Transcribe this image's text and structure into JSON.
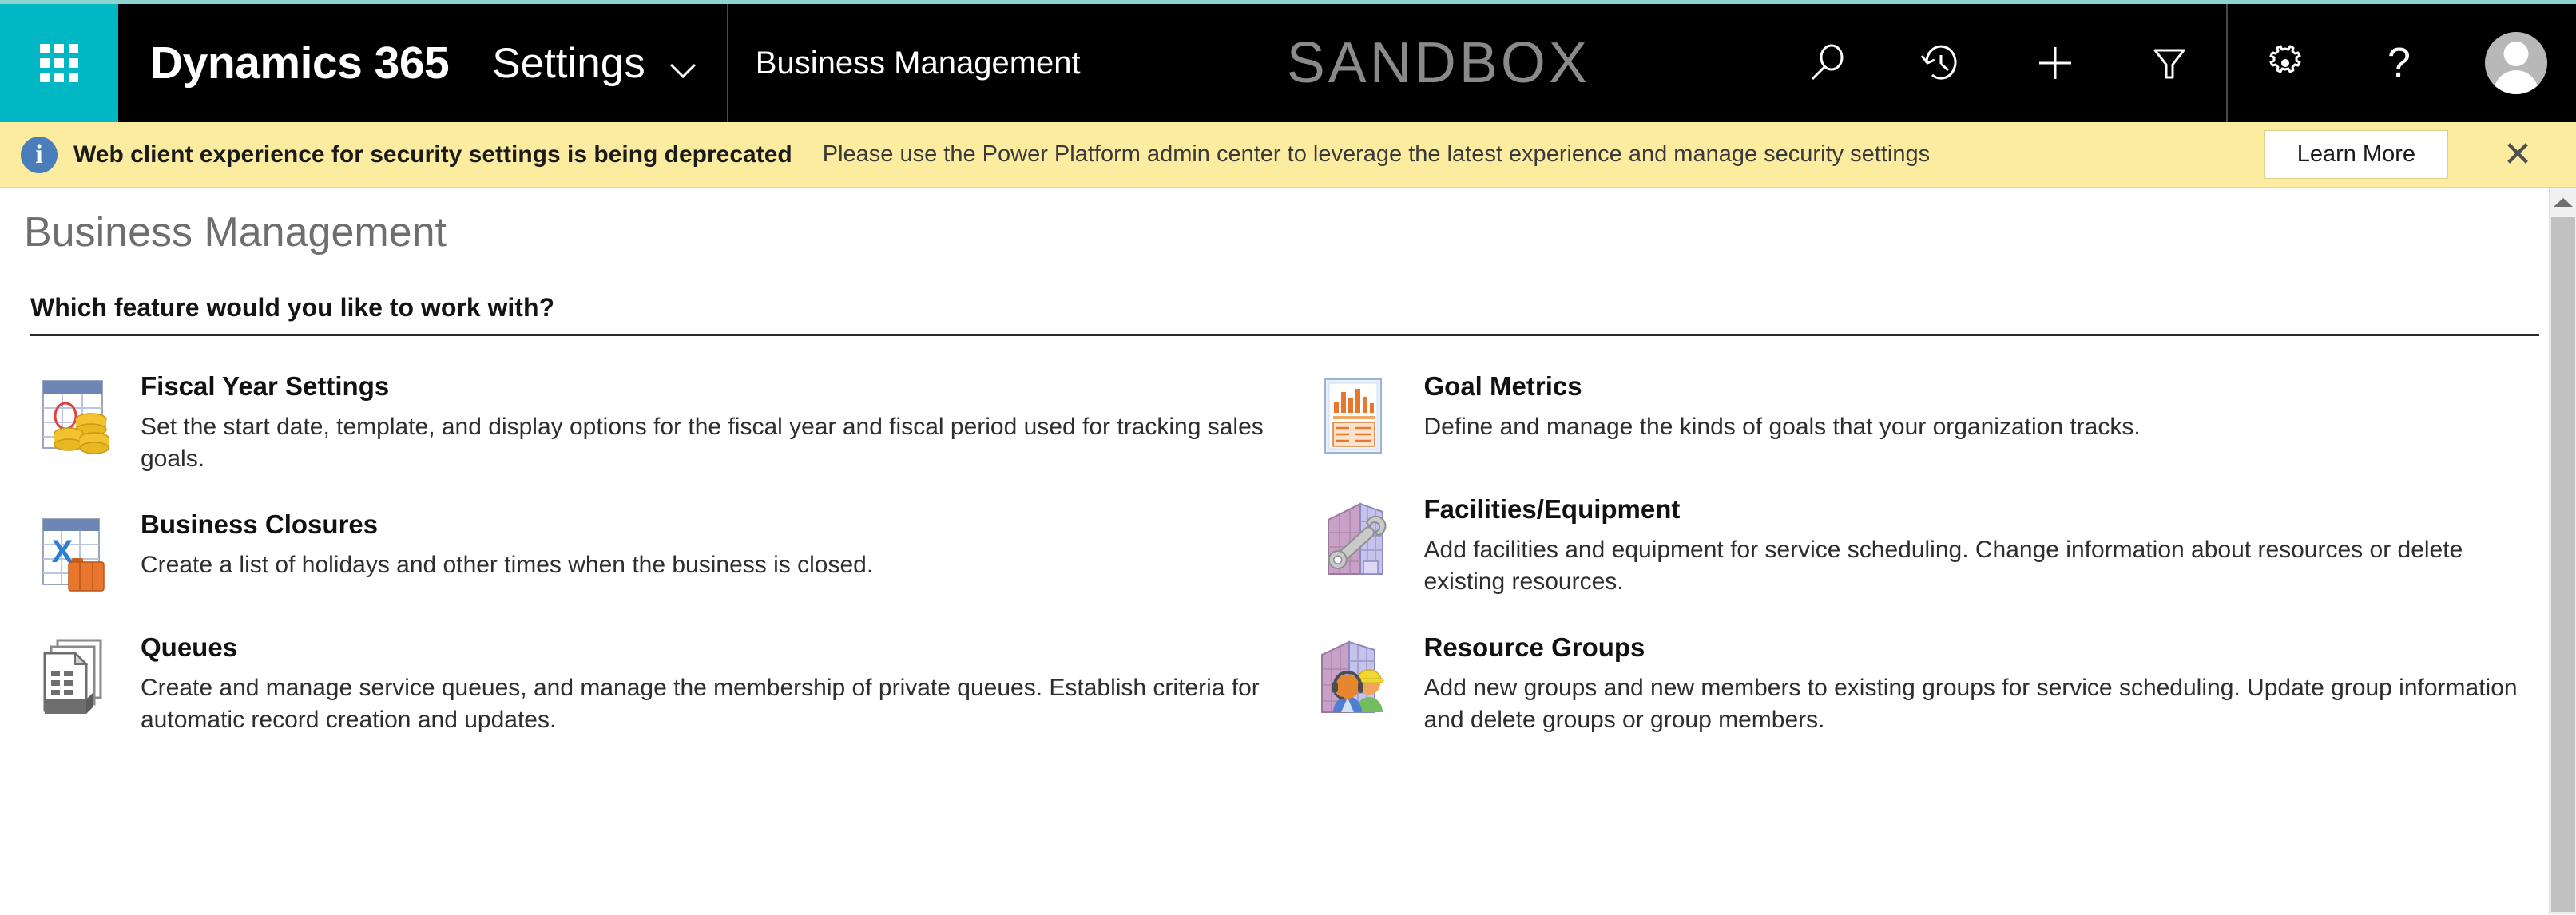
{
  "topbar": {
    "waffle_label": "App launcher",
    "brand": "Dynamics 365",
    "app_name": "Settings",
    "module_name": "Business Management",
    "environment_watermark": "SANDBOX",
    "accent_color": "#00b7c3",
    "accent_bar_color": "#8fd3ce",
    "background_color": "#000000",
    "icons": [
      {
        "name": "search-icon",
        "title": "Search"
      },
      {
        "name": "history-icon",
        "title": "Recently viewed"
      },
      {
        "name": "plus-icon",
        "title": "Quick create"
      },
      {
        "name": "filter-icon",
        "title": "Advanced find"
      },
      {
        "name": "gear-icon",
        "title": "Settings"
      },
      {
        "name": "help-icon",
        "title": "Help",
        "glyph": "?"
      }
    ],
    "avatar_label": "User profile"
  },
  "banner": {
    "info_glyph": "i",
    "title": "Web client experience for security settings is being deprecated",
    "message": "Please use the Power Platform admin center to leverage the latest experience and manage security settings",
    "action_label": "Learn More",
    "close_glyph": "✕",
    "background_color": "#fceca0"
  },
  "page": {
    "title": "Business Management",
    "section_heading": "Which feature would you like to work with?"
  },
  "features": {
    "left": [
      {
        "icon": "fiscal-year-calendar-coins-icon",
        "title": "Fiscal Year Settings",
        "description": "Set the start date, template, and display options for the fiscal year and fiscal period used for tracking sales goals."
      },
      {
        "icon": "business-closures-calendar-briefcase-icon",
        "title": "Business Closures",
        "description": "Create a list of holidays and other times when the business is closed."
      },
      {
        "icon": "queues-documents-icon",
        "title": "Queues",
        "description": "Create and manage service queues, and manage the membership of private queues. Establish criteria for automatic record creation and updates."
      }
    ],
    "right": [
      {
        "icon": "goal-metrics-chart-icon",
        "title": "Goal Metrics",
        "description": "Define and manage the kinds of goals that your organization tracks."
      },
      {
        "icon": "facilities-equipment-building-wrench-icon",
        "title": "Facilities/Equipment",
        "description": "Add facilities and equipment for service scheduling. Change information about resources or delete existing resources."
      },
      {
        "icon": "resource-groups-building-people-icon",
        "title": "Resource Groups",
        "description": "Add new groups and new members to existing groups for service scheduling. Update group information and delete groups or group members."
      }
    ]
  },
  "scrollbar": {
    "up_arrow_label": "Scroll up"
  }
}
